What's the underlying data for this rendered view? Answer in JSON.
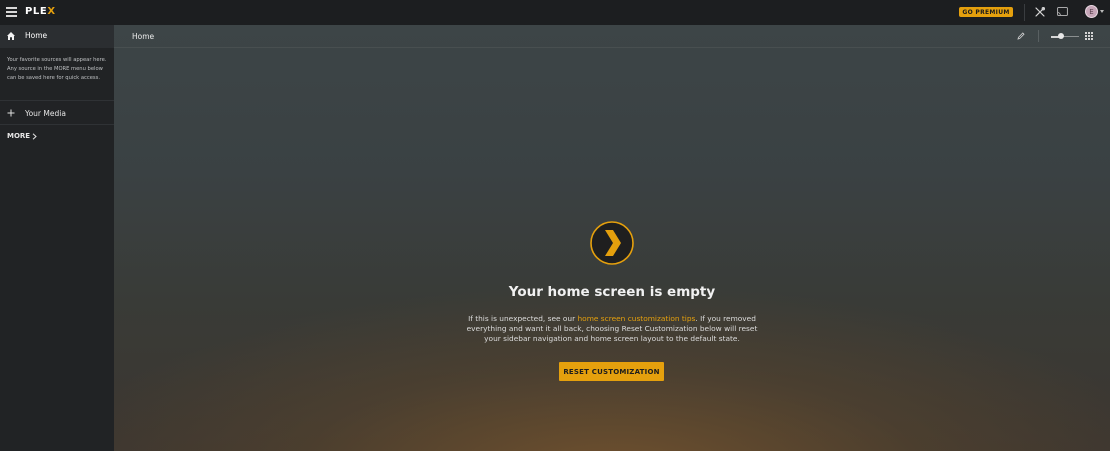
{
  "app": {
    "logo_text": "PLE",
    "logo_accent": "X",
    "accent_color": "#e5a00d"
  },
  "topbar": {
    "premium_label": "GO PREMIUM",
    "avatar_initial": "E",
    "icons": [
      "hamburger-icon",
      "tools-icon",
      "cast-icon",
      "avatar",
      "chevron-down-icon"
    ]
  },
  "sidebar": {
    "home_label": "Home",
    "info_text": "Your favorite sources will appear here. Any source in the MORE menu below can be saved here for quick access.",
    "media_label": "Your Media",
    "more_label": "MORE"
  },
  "main": {
    "title": "Home",
    "zoom_level": 0.35,
    "empty_title": "Your home screen is empty",
    "desc_before": "If this is unexpected, see our ",
    "desc_link": "home screen customization tips",
    "desc_after": ". If you removed everything and want it all back, choosing Reset Customization below will reset your sidebar navigation and home screen layout to the default state.",
    "reset_label": "RESET CUSTOMIZATION"
  }
}
